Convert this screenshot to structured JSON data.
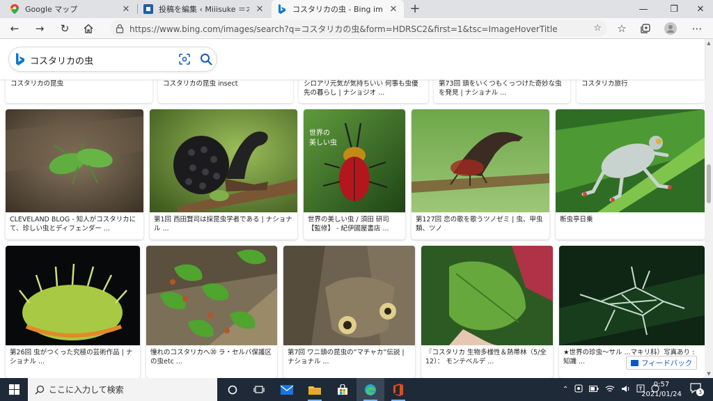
{
  "browser": {
    "tabs": [
      {
        "title": "Google マップ",
        "icon": "google-maps-icon",
        "active": false
      },
      {
        "title": "投稿を編集 ‹ Miiisuke ＝オンライン",
        "icon": "wordpress-icon",
        "active": false
      },
      {
        "title": "コスタリカの虫 - Bing images",
        "icon": "bing-icon",
        "active": true
      }
    ],
    "new_tab": "+",
    "url": "https://www.bing.com/images/search?q=コスタリカの虫&form=HDRSC2&first=1&tsc=ImageHoverTitle",
    "colors": {
      "tabstrip": "#dfe1e5",
      "active_tab": "#f7f7f7"
    }
  },
  "search": {
    "query": "コスタリカの虫",
    "accent": "#0b57c2"
  },
  "results": {
    "top_row": [
      {
        "caption": "コスタリカの昆虫"
      },
      {
        "caption": "コスタリカの昆虫 insect"
      },
      {
        "caption": "シロアリ元気が気持ちいい 何事も虫優先の暮らし | ナショジオ ..."
      },
      {
        "caption": "第73回 頭をいくつもくっつけた奇妙な虫を発見 | ナショナル ..."
      },
      {
        "caption": "コスタリカ旅行"
      }
    ],
    "row2": [
      {
        "caption": "CLEVELAND BLOG - 知人がコスタリカにて、珍しい虫とディフェンダー ...",
        "img": "green-leaf-insect-photo"
      },
      {
        "caption": "第1回 西田賢司は採昆虫学者である | ナショナル ...",
        "img": "black-treehopper-photo"
      },
      {
        "caption": "世界の美しい虫 / 須田 研司【監修】 - 紀伊國屋書店 ...",
        "img": "jewel-beetle-book-cover",
        "overlay": "世界の 美しい虫"
      },
      {
        "caption": "第127回 恋の歌を歌うツノゼミ | 虫、甲虫類、ツノ",
        "img": "treehopper-on-branch-photo"
      },
      {
        "caption": "断虫亭日乗",
        "img": "glass-frog-photo"
      }
    ],
    "row3": [
      {
        "caption": "第26回 虫がつくった究極の芸術作品 | ナショナル ...",
        "img": "green-spiky-caterpillar-photo"
      },
      {
        "caption": "憧れのコスタリカへ⑳ ラ・セルバ保護区の虫etc ...",
        "img": "leafcutter-ants-photo"
      },
      {
        "caption": "第7回 ワニ頭の昆虫の”マチャカ”伝説 | ナショナル ...",
        "img": "lanternfly-eyespot-photo"
      },
      {
        "caption": "『コスタリカ 生物多様性＆熱帯林（5/全12）： モンテベルデ ...",
        "img": "leaf-katydid-photo"
      },
      {
        "caption": "★世界の珍虫～サル ...マキリ科）写真あり : 知識 ...",
        "img": "lichen-katydid-photo"
      }
    ],
    "feedback": "フィードバック"
  },
  "taskbar": {
    "search_placeholder": "ここに入力して検索",
    "time": "0:57",
    "date": "2021/01/24",
    "notification_count": "3",
    "colors": {
      "bar": "#1f2a38"
    }
  }
}
